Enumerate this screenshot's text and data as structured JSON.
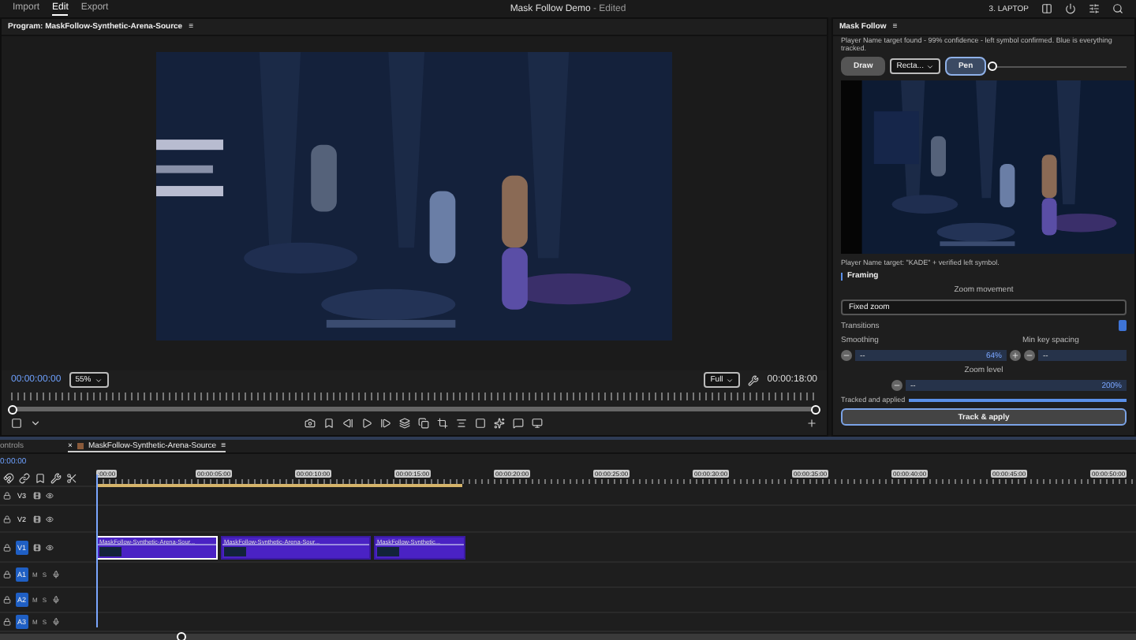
{
  "menu": [
    {
      "label": "Import",
      "selected": false
    },
    {
      "label": "Edit",
      "selected": true
    },
    {
      "label": "Export",
      "selected": false
    }
  ],
  "title": {
    "name": "Mask Follow Demo",
    "suffix": "- Edited"
  },
  "workspace": "3. LAPTOP",
  "program": {
    "title": "Program: MaskFollow-Synthetic-Arena-Source",
    "menu": "≡",
    "timecode": "00:00:00:00",
    "zoom": "55%",
    "quality": "Full",
    "duration": "00:00:18:00"
  },
  "mask_follow": {
    "title": "Mask Follow",
    "menu": "≡",
    "status": "Player Name target found - 99% confidence - left symbol confirmed. Blue is everything tracked.",
    "tools": [
      {
        "kind": "button",
        "label": "Draw",
        "selected": false
      },
      {
        "kind": "select",
        "label": "Recta..."
      },
      {
        "kind": "button",
        "label": "Pen",
        "selected": true
      }
    ],
    "brush": {
      "level": 0
    },
    "caption": "Player Name target: \"KADE\" + verified left symbol.",
    "framing": {
      "title": "Framing",
      "movement_label": "Zoom movement",
      "movement": "Fixed zoom",
      "transitions": {
        "label": "Transitions",
        "on": true
      },
      "smoothing": {
        "label": "Smoothing",
        "display": "--",
        "reading": "64%"
      },
      "spacing": {
        "label": "Min key spacing",
        "display": "--"
      },
      "zoom_level": {
        "label": "Zoom level",
        "display": "--",
        "reading": "200%"
      }
    },
    "progress": {
      "label": "Tracked and applied",
      "level": 1
    },
    "apply": "Track & apply"
  },
  "timeline": {
    "tabs": [
      {
        "label": "ontrols",
        "selected": false
      },
      {
        "label": "MaskFollow-Synthetic-Arena-Source",
        "selected": true,
        "close": "×",
        "menu": "≡"
      }
    ],
    "timecode": "0:00:00",
    "ruler": [
      ":00:00",
      "00:00:05:00",
      "00:00:10:00",
      "00:00:15:00",
      "00:00:20:00",
      "00:00:25:00",
      "00:00:30:00",
      "00:00:35:00",
      "00:00:40:00",
      "00:00:45:00",
      "00:00:50:00"
    ],
    "tracks": [
      {
        "kind": "video",
        "label": "V3",
        "targeted": false
      },
      {
        "kind": "video",
        "label": "V2",
        "targeted": false
      },
      {
        "kind": "video",
        "label": "V1",
        "targeted": true,
        "clips": [
          {
            "label": "MaskFollow-Synthetic-Arena-Sour...",
            "selected": true
          },
          {
            "label": "MaskFollow-Synthetic-Arena-Sour...",
            "selected": false
          },
          {
            "label": "MaskFollow-Synthetic...",
            "selected": false
          }
        ]
      },
      {
        "kind": "audio",
        "label": "A1",
        "targeted": true,
        "mute": "M",
        "solo": "S"
      },
      {
        "kind": "audio",
        "label": "A2",
        "targeted": true,
        "mute": "M",
        "solo": "S"
      },
      {
        "kind": "audio",
        "label": "A3",
        "targeted": true,
        "mute": "M",
        "solo": "S"
      }
    ]
  }
}
